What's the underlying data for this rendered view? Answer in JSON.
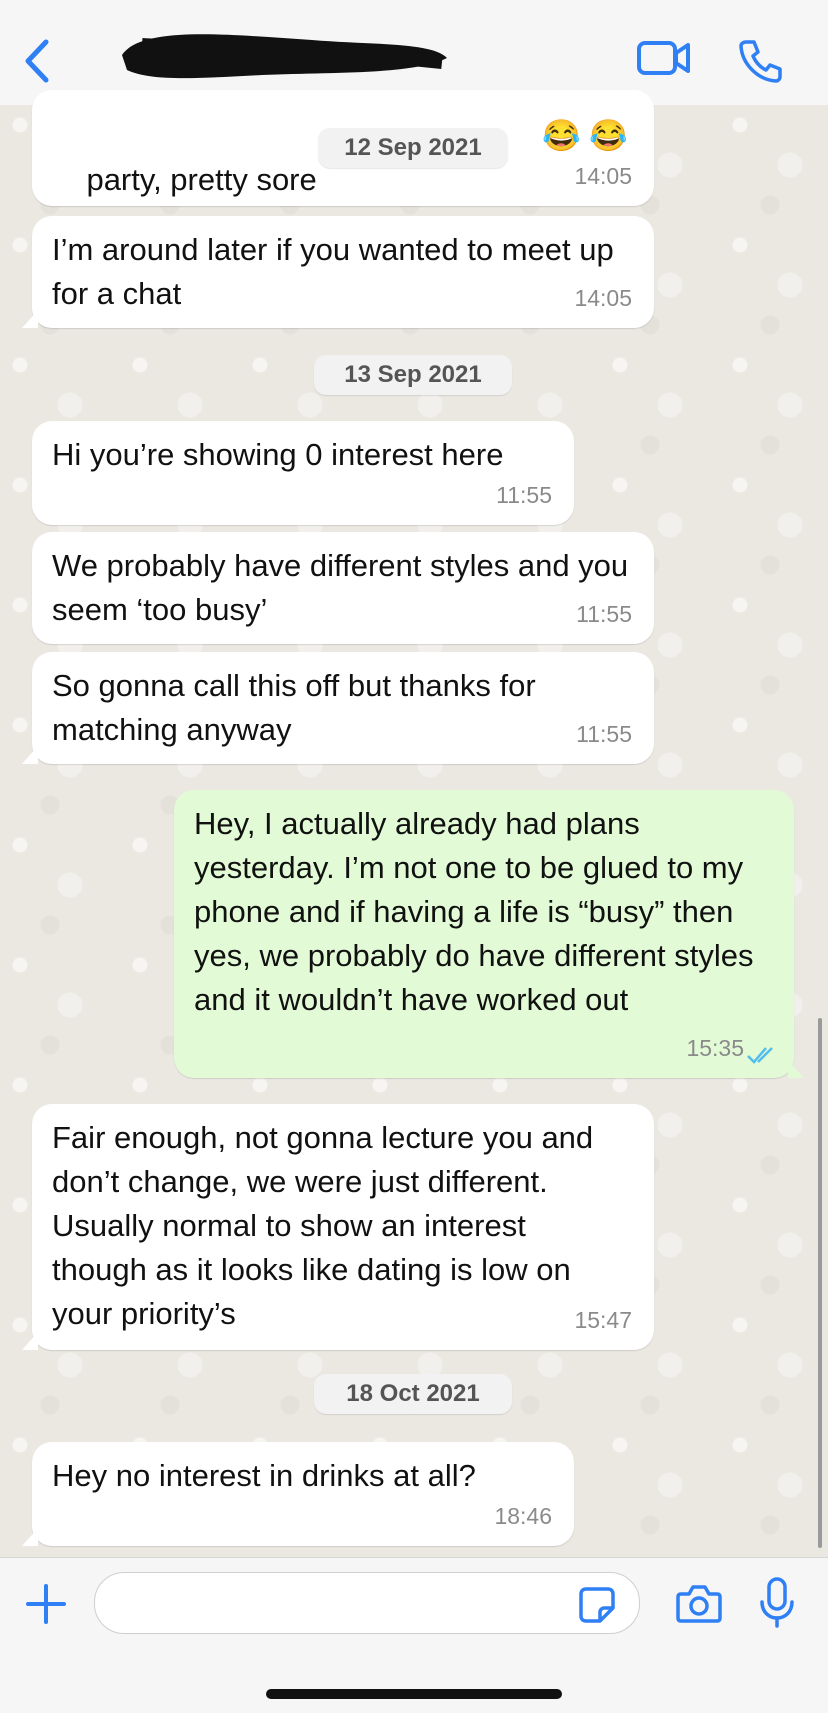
{
  "header": {
    "contact_name": "",
    "icons": [
      "chevron-left-icon",
      "video-camera-icon",
      "phone-icon"
    ],
    "accent_color": "#2f7ff5"
  },
  "messages": [
    {
      "type": "in",
      "text": "party, pretty sore ",
      "time": "14:05",
      "emoji": "😂 😂"
    },
    {
      "type": "in",
      "text": "I’m around later if you wanted to meet up for a chat",
      "time": "14:05"
    },
    {
      "type": "date",
      "text": "13 Sep 2021"
    },
    {
      "type": "in",
      "text": "Hi you’re showing 0 interest here",
      "time": "11:55"
    },
    {
      "type": "in",
      "text": "We probably have different styles and you seem ‘too busy’",
      "time": "11:55"
    },
    {
      "type": "in",
      "text": "So gonna call this off but thanks for matching anyway",
      "time": "11:55"
    },
    {
      "type": "out",
      "text": "Hey, I actually already had plans yesterday. I’m not one to be glued to my phone and if having a life is “busy” then yes, we probably do have different styles and it wouldn’t have worked out",
      "time": "15:35",
      "status": "read"
    },
    {
      "type": "in",
      "text": "Fair enough, not gonna lecture you and don’t change, we were just different. Usually normal to show an interest though as it looks like dating is low on your priority’s",
      "time": "15:47"
    },
    {
      "type": "date",
      "text": "18 Oct 2021"
    },
    {
      "type": "in",
      "text": "Hey no interest in drinks at all?",
      "time": "18:46"
    }
  ],
  "floating_date": "12 Sep 2021",
  "input_bar": {
    "placeholder": "",
    "icons": [
      "plus-icon",
      "sticker-icon",
      "camera-icon",
      "microphone-icon"
    ]
  },
  "colors": {
    "outgoing_bubble": "#e2fbd6",
    "incoming_bubble": "#ffffff",
    "read_ticks": "#53bdeb"
  }
}
